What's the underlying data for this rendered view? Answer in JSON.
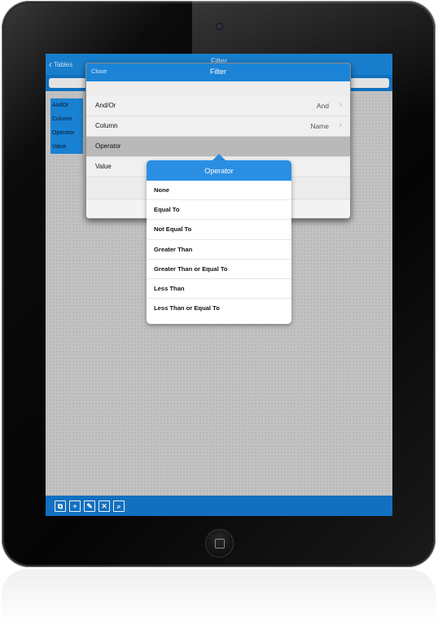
{
  "nav": {
    "back_label": "Tables",
    "title": "Filter"
  },
  "side_list": {
    "items": [
      "AndOr",
      "Column",
      "Operator",
      "Value"
    ]
  },
  "modal": {
    "close_label": "Close",
    "title": "Filter",
    "rows": [
      {
        "label": "And/Or",
        "value": "And"
      },
      {
        "label": "Column",
        "value": "Name"
      },
      {
        "label": "Operator",
        "value": ""
      },
      {
        "label": "Value",
        "value": ""
      }
    ]
  },
  "popover": {
    "title": "Operator",
    "options": [
      "None",
      "Equal To",
      "Not Equal To",
      "Greater Than",
      "Greater Than or Equal To",
      "Less Than",
      "Less Than or Equal To"
    ]
  },
  "toolbar": {
    "icons": [
      "copy-icon",
      "plus-icon",
      "edit-icon",
      "delete-icon",
      "search-icon"
    ],
    "glyphs": [
      "⧉",
      "+",
      "✎",
      "✕",
      "⌕"
    ]
  },
  "colors": {
    "accent": "#1a86d9",
    "popover_header": "#2a8fe3",
    "toolbar": "#1478cc"
  }
}
